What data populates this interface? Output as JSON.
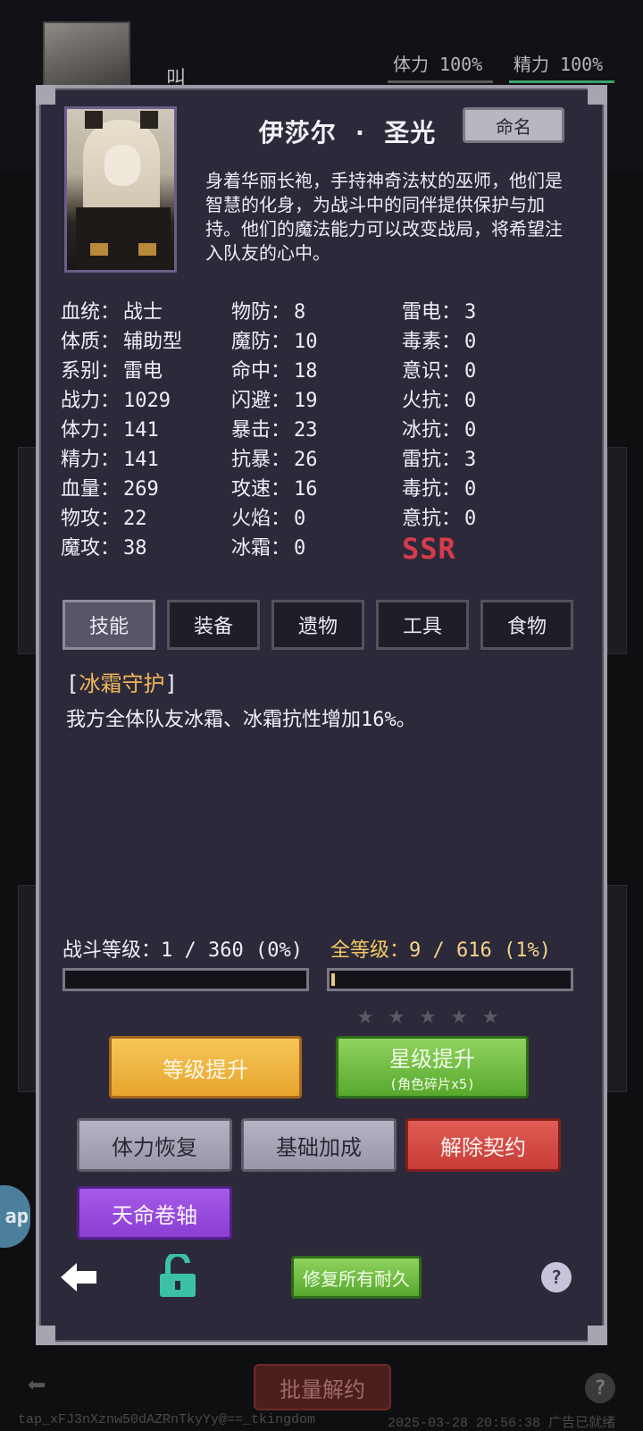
{
  "background": {
    "char_label": "叫",
    "stamina": "体力 100%",
    "energy": "精力 100%",
    "batch_button": "批量解约",
    "side_badge": "ap",
    "footer_left": "tap_xFJ3nXznw50dAZRnTkyYy@==_tkingdom",
    "footer_right": "2025-03-28 20:56:38 广告已就绪"
  },
  "character": {
    "name": "伊莎尔 · 圣光",
    "rename_label": "命名",
    "description": "身着华丽长袍，手持神奇法杖的巫师，他们是智慧的化身，为战斗中的同伴提供保护与加持。他们的魔法能力可以改变战局，将希望注入队友的心中。",
    "rarity": "SSR"
  },
  "stats": {
    "col1": [
      {
        "label": "血统：",
        "value": "战士"
      },
      {
        "label": "体质：",
        "value": "辅助型"
      },
      {
        "label": "系别：",
        "value": "雷电"
      },
      {
        "label": "战力：",
        "value": "1029"
      },
      {
        "label": "体力：",
        "value": "141"
      },
      {
        "label": "精力：",
        "value": "141"
      },
      {
        "label": "血量：",
        "value": "269"
      },
      {
        "label": "物攻：",
        "value": "22"
      },
      {
        "label": "魔攻：",
        "value": "38"
      }
    ],
    "col2": [
      {
        "label": "物防：",
        "value": "8"
      },
      {
        "label": "魔防：",
        "value": "10"
      },
      {
        "label": "命中：",
        "value": "18"
      },
      {
        "label": "闪避：",
        "value": "19"
      },
      {
        "label": "暴击：",
        "value": "23"
      },
      {
        "label": "抗暴：",
        "value": "26"
      },
      {
        "label": "攻速：",
        "value": "16"
      },
      {
        "label": "火焰：",
        "value": "0"
      },
      {
        "label": "冰霜：",
        "value": "0"
      }
    ],
    "col3": [
      {
        "label": "雷电：",
        "value": "3"
      },
      {
        "label": "毒素：",
        "value": "0"
      },
      {
        "label": "意识：",
        "value": "0"
      },
      {
        "label": "火抗：",
        "value": "0"
      },
      {
        "label": "冰抗：",
        "value": "0"
      },
      {
        "label": "雷抗：",
        "value": "3"
      },
      {
        "label": "毒抗：",
        "value": "0"
      },
      {
        "label": "意抗：",
        "value": "0"
      }
    ]
  },
  "tabs": [
    "技能",
    "装备",
    "遗物",
    "工具",
    "食物"
  ],
  "active_tab": 0,
  "skill": {
    "bracket_open": "[",
    "name": "冰霜守护",
    "bracket_close": "]",
    "description": "我方全体队友冰霜、冰霜抗性增加16%。"
  },
  "levels": {
    "battle_label": "战斗等级：1 / 360 (0%)",
    "battle_progress": 0,
    "total_prefix": "全等级：",
    "total_value": "9 / 616 (1%)",
    "total_progress": 0.01,
    "stars_filled": 0,
    "stars_total": 5
  },
  "buttons": {
    "level_up": "等级提升",
    "star_up": "星级提升",
    "star_up_sub": "(角色碎片x5)",
    "stamina_restore": "体力恢复",
    "base_bonus": "基础加成",
    "terminate": "解除契约",
    "destiny_scroll": "天命卷轴",
    "repair_all": "修复所有耐久",
    "help": "?"
  },
  "colors": {
    "panel": "#2c2a3a",
    "skill_highlight": "#f3b65a",
    "rarity": "#d83b4c"
  }
}
